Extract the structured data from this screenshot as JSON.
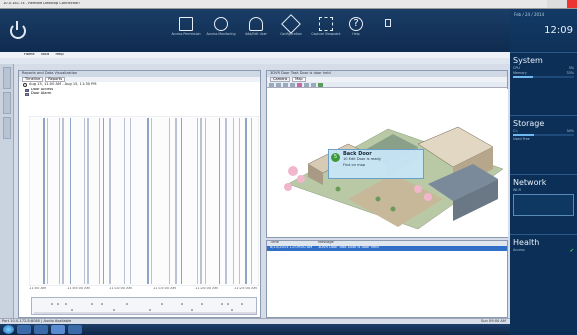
{
  "window": {
    "title": "10.0.181.74 - Remote Desktop Connection"
  },
  "toolbar": {
    "buttons": [
      {
        "label": "Access Permission",
        "icon": "document-icon"
      },
      {
        "label": "Access Monitoring",
        "icon": "camera-icon"
      },
      {
        "label": "Add/Edit User",
        "icon": "person-icon"
      },
      {
        "label": "Configuration",
        "icon": "tools-icon"
      },
      {
        "label": "Capture Viewpoint",
        "icon": "frame-icon"
      },
      {
        "label": "Help",
        "icon": "help-icon"
      }
    ]
  },
  "clock": {
    "date": "Feb / 24 / 2014",
    "time": "12:09"
  },
  "side": {
    "system": {
      "title": "System",
      "rows": [
        {
          "label": "CPU",
          "value": "3%",
          "level": 0.03
        },
        {
          "label": "Memory",
          "value": "33%",
          "level": 0.33
        }
      ]
    },
    "storage": {
      "title": "Storage",
      "rows": [
        {
          "label": "C:\\",
          "value": "34%",
          "level": 0.34
        }
      ],
      "legend": "Used   Free"
    },
    "network": {
      "title": "Network",
      "rows": [
        {
          "label": "Wi-Fi",
          "value": ""
        }
      ]
    },
    "health": {
      "title": "Health",
      "rows": [
        {
          "label": "Access",
          "value": ""
        }
      ]
    }
  },
  "menu": {
    "items": [
      "Home",
      "Tools",
      "Help"
    ],
    "breadcrumb": "Reports and Data Visualization"
  },
  "left_pane": {
    "title": "Reports and Data Visualization",
    "tabs": [
      "Timeline",
      "Reports"
    ],
    "time_range": "Aug 15, 11:00 AM - Aug 15, 11:30 PM",
    "legend": [
      {
        "label": "Door Access",
        "color": "#5a7fc7"
      },
      {
        "label": "Door Alarm",
        "color": "#9a9a9a"
      }
    ],
    "axis_labels": [
      "11:00 AM",
      "11:05:00 AM",
      "11:10:00 AM",
      "11:15:00 AM",
      "11:20:00 AM",
      "11:25:00 AM"
    ]
  },
  "right_pane": {
    "title": "3DVR Door Task Door is door held",
    "tabs": [
      "Camera",
      "Map"
    ],
    "popup": {
      "badge": "5",
      "title": "Back Door",
      "line1": "10 Edit Door is ready",
      "link": "Find on map"
    }
  },
  "events": {
    "columns": [
      "Time",
      "Message"
    ],
    "selected": {
      "time": "8/15/2013 11:09:00 AM",
      "message": "3DVR Door Task Door is door held"
    }
  },
  "statusbar": {
    "left": "Port 10.0.172.8:8080 | Audio Available",
    "right": [
      "Sun 09:00 AM"
    ]
  }
}
